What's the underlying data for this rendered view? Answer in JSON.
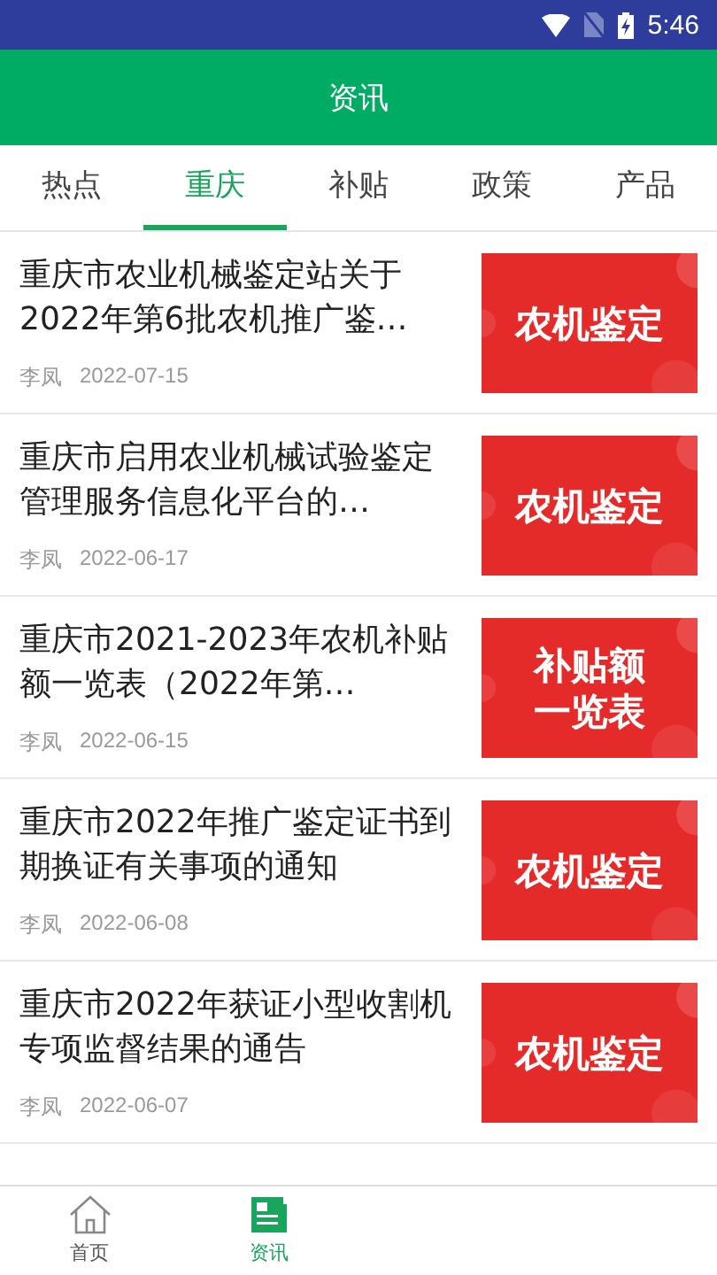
{
  "status_bar": {
    "time": "5:46"
  },
  "header": {
    "title": "资讯"
  },
  "tabs": [
    {
      "label": "热点",
      "selected": false
    },
    {
      "label": "重庆",
      "selected": true
    },
    {
      "label": "补贴",
      "selected": false
    },
    {
      "label": "政策",
      "selected": false
    },
    {
      "label": "产品",
      "selected": false
    }
  ],
  "articles": [
    {
      "title": "重庆市农业机械鉴定站关于2022年第6批农机推广鉴…",
      "author": "李凤",
      "date": "2022-07-15",
      "thumb_text": [
        "农机鉴定"
      ]
    },
    {
      "title": "重庆市启用农业机械试验鉴定管理服务信息化平台的…",
      "author": "李凤",
      "date": "2022-06-17",
      "thumb_text": [
        "农机鉴定"
      ]
    },
    {
      "title": "重庆市2021-2023年农机补贴额一览表（2022年第…",
      "author": "李凤",
      "date": "2022-06-15",
      "thumb_text": [
        "补贴额",
        "一览表"
      ]
    },
    {
      "title": "重庆市2022年推广鉴定证书到期换证有关事项的通知",
      "author": "李凤",
      "date": "2022-06-08",
      "thumb_text": [
        "农机鉴定"
      ]
    },
    {
      "title": "重庆市2022年获证小型收割机专项监督结果的通告",
      "author": "李凤",
      "date": "2022-06-07",
      "thumb_text": [
        "农机鉴定"
      ]
    }
  ],
  "bottom_nav": [
    {
      "label": "首页",
      "kind": "home",
      "selected": false
    },
    {
      "label": "资讯",
      "kind": "news",
      "selected": true
    }
  ]
}
